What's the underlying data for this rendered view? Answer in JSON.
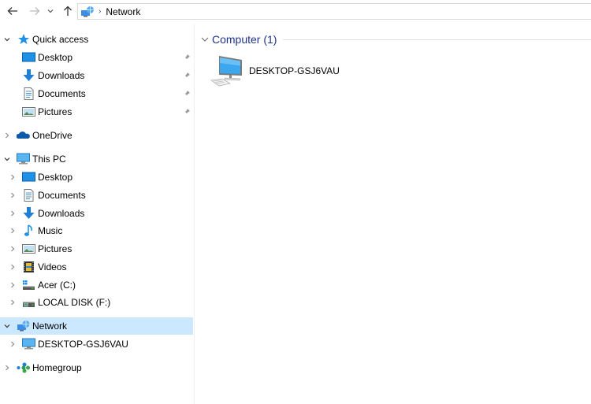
{
  "navigation": {
    "back": "back-arrow",
    "forward": "forward-arrow",
    "recent": "chevron-down",
    "up": "up-arrow"
  },
  "address_bar": {
    "icon": "network-icon",
    "separator": "›",
    "crumbs": [
      "Network"
    ]
  },
  "nav_pane": {
    "quick_access": {
      "label": "Quick access",
      "items": [
        {
          "label": "Desktop",
          "icon": "desktop-icon",
          "pinned": true
        },
        {
          "label": "Downloads",
          "icon": "downloads-icon",
          "pinned": true
        },
        {
          "label": "Documents",
          "icon": "documents-icon",
          "pinned": true
        },
        {
          "label": "Pictures",
          "icon": "pictures-icon",
          "pinned": true
        }
      ]
    },
    "onedrive": {
      "label": "OneDrive"
    },
    "this_pc": {
      "label": "This PC",
      "items": [
        {
          "label": "Desktop",
          "icon": "desktop-icon"
        },
        {
          "label": "Documents",
          "icon": "documents-icon"
        },
        {
          "label": "Downloads",
          "icon": "downloads-icon"
        },
        {
          "label": "Music",
          "icon": "music-icon"
        },
        {
          "label": "Pictures",
          "icon": "pictures-icon"
        },
        {
          "label": "Videos",
          "icon": "videos-icon"
        },
        {
          "label": "Acer (C:)",
          "icon": "system-drive-icon"
        },
        {
          "label": "LOCAL DISK (F:)",
          "icon": "local-disk-icon"
        }
      ]
    },
    "network": {
      "label": "Network",
      "selected": true,
      "items": [
        {
          "label": "DESKTOP-GSJ6VAU",
          "icon": "computer-icon"
        }
      ]
    },
    "homegroup": {
      "label": "Homegroup"
    }
  },
  "content": {
    "groups": [
      {
        "title": "Computer (1)",
        "items": [
          {
            "name": "DESKTOP-GSJ6VAU",
            "icon": "computer-icon"
          }
        ]
      }
    ]
  },
  "colors": {
    "selection": "#cce8ff",
    "group_header": "#1e3287",
    "accent_blue": "#1e90e6"
  }
}
